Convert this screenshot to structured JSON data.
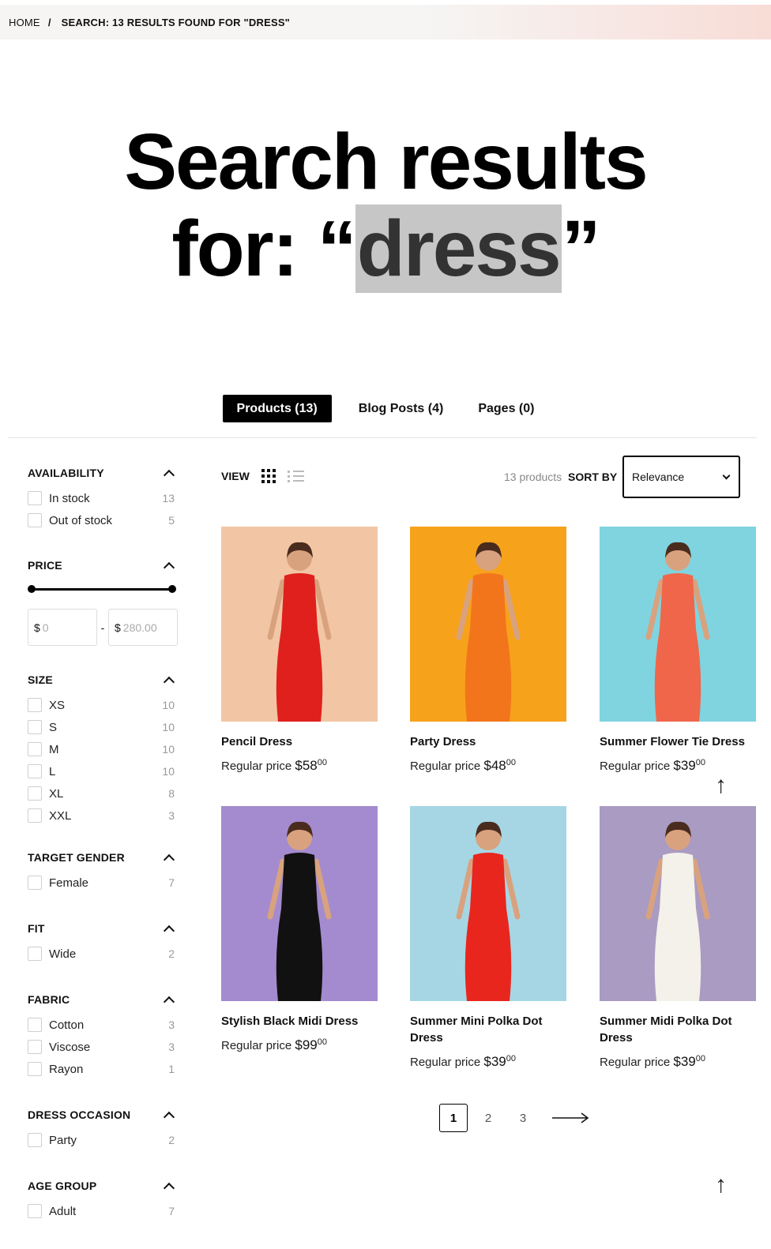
{
  "breadcrumb": {
    "home": "HOME",
    "separator": "/",
    "current": "SEARCH: 13 RESULTS FOUND FOR \"DRESS\""
  },
  "hero": {
    "line1": "Search results",
    "prefix": "for: “",
    "term": "dress",
    "suffix": "”"
  },
  "tabs": [
    {
      "label": "Products (13)",
      "active": true
    },
    {
      "label": "Blog Posts (4)",
      "active": false
    },
    {
      "label": "Pages (0)",
      "active": false
    }
  ],
  "toolbar": {
    "view_label": "VIEW",
    "count_label": "13 products",
    "sort_label": "SORT BY",
    "sort_value": "Relevance",
    "grid_icon": "grid-icon",
    "list_icon": "list-icon"
  },
  "filters": {
    "availability": {
      "title": "AVAILABILITY",
      "items": [
        {
          "label": "In stock",
          "count": "13"
        },
        {
          "label": "Out of stock",
          "count": "5"
        }
      ]
    },
    "price": {
      "title": "PRICE",
      "currency": "$",
      "min_placeholder": "0",
      "max_placeholder": "280.00",
      "range": [
        0,
        280
      ]
    },
    "size": {
      "title": "SIZE",
      "items": [
        {
          "label": "XS",
          "count": "10"
        },
        {
          "label": "S",
          "count": "10"
        },
        {
          "label": "M",
          "count": "10"
        },
        {
          "label": "L",
          "count": "10"
        },
        {
          "label": "XL",
          "count": "8"
        },
        {
          "label": "XXL",
          "count": "3"
        }
      ]
    },
    "gender": {
      "title": "TARGET GENDER",
      "items": [
        {
          "label": "Female",
          "count": "7"
        }
      ]
    },
    "fit": {
      "title": "FIT",
      "items": [
        {
          "label": "Wide",
          "count": "2"
        }
      ]
    },
    "fabric": {
      "title": "FABRIC",
      "items": [
        {
          "label": "Cotton",
          "count": "3"
        },
        {
          "label": "Viscose",
          "count": "3"
        },
        {
          "label": "Rayon",
          "count": "1"
        }
      ]
    },
    "occasion": {
      "title": "DRESS OCCASION",
      "items": [
        {
          "label": "Party",
          "count": "2"
        }
      ]
    },
    "age": {
      "title": "AGE GROUP",
      "items": [
        {
          "label": "Adult",
          "count": "7"
        }
      ]
    }
  },
  "products": [
    {
      "name": "Pencil Dress",
      "price_label": "Regular price",
      "price": "$58",
      "cents": "00",
      "bg": "#f2c6a4",
      "dress": "#e0201c"
    },
    {
      "name": "Party Dress",
      "price_label": "Regular price",
      "price": "$48",
      "cents": "00",
      "bg": "#f7a21b",
      "dress": "#f2751c"
    },
    {
      "name": "Summer Flower Tie Dress",
      "price_label": "Regular price",
      "price": "$39",
      "cents": "00",
      "bg": "#7fd4e0",
      "dress": "#f0664a"
    },
    {
      "name": "Stylish Black Midi Dress",
      "price_label": "Regular price",
      "price": "$99",
      "cents": "00",
      "bg": "#a48bcf",
      "dress": "#111111"
    },
    {
      "name": "Summer Mini Polka Dot Dress",
      "price_label": "Regular price",
      "price": "$39",
      "cents": "00",
      "bg": "#a6d6e4",
      "dress": "#e8261e"
    },
    {
      "name": "Summer Midi Polka Dot Dress",
      "price_label": "Regular price",
      "price": "$39",
      "cents": "00",
      "bg": "#a99bc2",
      "dress": "#f3f1ea"
    }
  ],
  "pagination": {
    "pages": [
      "1",
      "2",
      "3"
    ],
    "current": "1",
    "next_icon": "arrow-right-icon"
  }
}
